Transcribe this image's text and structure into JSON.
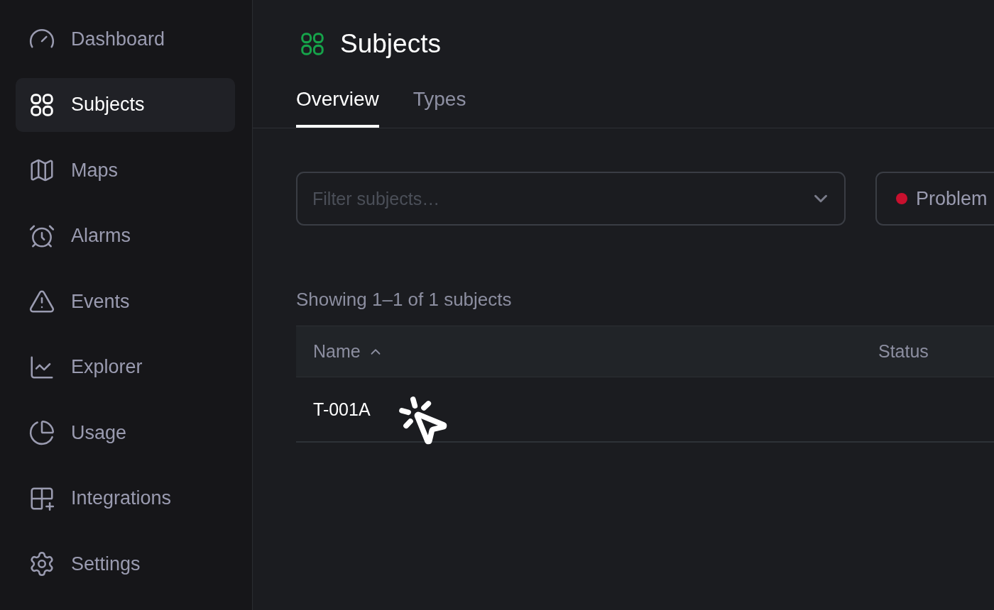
{
  "sidebar": {
    "items": [
      {
        "label": "Dashboard",
        "selected": false
      },
      {
        "label": "Subjects",
        "selected": true
      },
      {
        "label": "Maps",
        "selected": false
      },
      {
        "label": "Alarms",
        "selected": false
      },
      {
        "label": "Events",
        "selected": false
      },
      {
        "label": "Explorer",
        "selected": false
      },
      {
        "label": "Usage",
        "selected": false
      },
      {
        "label": "Integrations",
        "selected": false
      },
      {
        "label": "Settings",
        "selected": false
      }
    ]
  },
  "header": {
    "title": "Subjects"
  },
  "tabs": [
    {
      "label": "Overview",
      "selected": true
    },
    {
      "label": "Types",
      "selected": false
    }
  ],
  "filters": {
    "search": {
      "placeholder": "Filter subjects…"
    },
    "status_filter": {
      "label": "Problem",
      "color": "#c8102e"
    }
  },
  "summary": "Showing 1–1 of 1 subjects",
  "table": {
    "columns": [
      {
        "label": "Name",
        "sorted": true
      },
      {
        "label": "Status",
        "sorted": false
      }
    ],
    "rows": [
      {
        "name": "T-001A"
      }
    ]
  }
}
